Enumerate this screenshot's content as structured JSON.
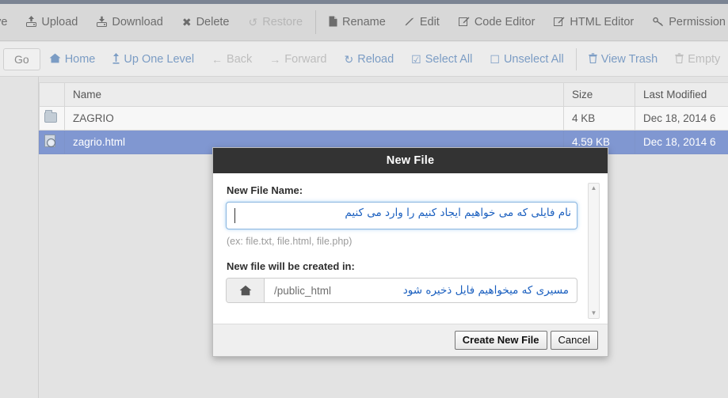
{
  "toolbar": {
    "items": [
      {
        "label": "ove",
        "icon": "move-icon",
        "glyph": "",
        "disabled": false,
        "truncated": true
      },
      {
        "label": "Upload",
        "icon": "upload-icon",
        "glyph": "⤒",
        "disabled": false
      },
      {
        "label": "Download",
        "icon": "download-icon",
        "glyph": "⤓",
        "disabled": false
      },
      {
        "label": "Delete",
        "icon": "delete-x-icon",
        "glyph": "✖",
        "disabled": false
      },
      {
        "label": "Restore",
        "icon": "restore-icon",
        "glyph": "↺",
        "disabled": true
      },
      {
        "label": "Rename",
        "icon": "rename-file-icon",
        "glyph": "◧",
        "disabled": false
      },
      {
        "label": "Edit",
        "icon": "pencil-icon",
        "glyph": "✐",
        "disabled": false
      },
      {
        "label": "Code Editor",
        "icon": "code-editor-icon",
        "glyph": "✎",
        "disabled": false
      },
      {
        "label": "HTML Editor",
        "icon": "html-editor-icon",
        "glyph": "✎",
        "disabled": false
      },
      {
        "label": "Permission",
        "icon": "key-icon",
        "glyph": "⚷",
        "disabled": false,
        "truncated": true
      }
    ]
  },
  "navbar": {
    "go_label": "Go",
    "items": [
      {
        "label": "Home",
        "icon": "home-icon",
        "glyph": "⌂",
        "disabled": false
      },
      {
        "label": "Up One Level",
        "icon": "up-level-icon",
        "glyph": "↕",
        "disabled": false
      },
      {
        "label": "Back",
        "icon": "back-arrow-icon",
        "glyph": "←",
        "disabled": true
      },
      {
        "label": "Forward",
        "icon": "forward-arrow-icon",
        "glyph": "→",
        "disabled": true
      },
      {
        "label": "Reload",
        "icon": "reload-icon",
        "glyph": "↻",
        "disabled": false
      },
      {
        "label": "Select All",
        "icon": "checkbox-checked-icon",
        "glyph": "☑",
        "disabled": false
      },
      {
        "label": "Unselect All",
        "icon": "checkbox-empty-icon",
        "glyph": "☐",
        "disabled": false
      },
      {
        "label": "View Trash",
        "icon": "trash-icon",
        "glyph": "Ὕ1",
        "disabled": false
      },
      {
        "label": "Empty",
        "icon": "trash-icon",
        "glyph": "Ὕ1",
        "disabled": true,
        "truncated": true
      }
    ]
  },
  "file_table": {
    "columns": [
      "",
      "Name",
      "Size",
      "Last Modified"
    ],
    "rows": [
      {
        "icon": "folder-icon",
        "name": "ZAGRIO",
        "size": "4 KB",
        "modified": "Dec 18, 2014 6",
        "selected": false
      },
      {
        "icon": "html-file-icon",
        "name": "zagrio.html",
        "size": "4.59 KB",
        "modified": "Dec 18, 2014 6",
        "selected": true
      }
    ]
  },
  "modal": {
    "title": "New File",
    "name_label": "New File Name:",
    "name_value": "",
    "name_placeholder": "",
    "name_annotation_fa": "نام فایلی که می خواهیم ایجاد کنیم را وارد می کنیم",
    "hint": "(ex: file.txt, file.html, file.php)",
    "path_label": "New file will be created in:",
    "path_icon": "home-icon",
    "path_glyph": "⌂",
    "path_value": "/public_html",
    "path_annotation_fa": "مسیری که میخواهیم فایل ذخیره شود",
    "scroll_up_glyph": "▲",
    "scroll_down_glyph": "▼",
    "create_label": "Create New File",
    "cancel_label": "Cancel"
  },
  "colors": {
    "top_strip": "#7b8493",
    "toolbar_bg": "#d8d8d8",
    "navbar_bg": "#ececec",
    "nav_link": "#7b9cc4",
    "selected_row": "#8097d1",
    "modal_header_bg": "#333333",
    "annotation": "#1a5fbf",
    "page_bg": "#e3e3e3"
  }
}
